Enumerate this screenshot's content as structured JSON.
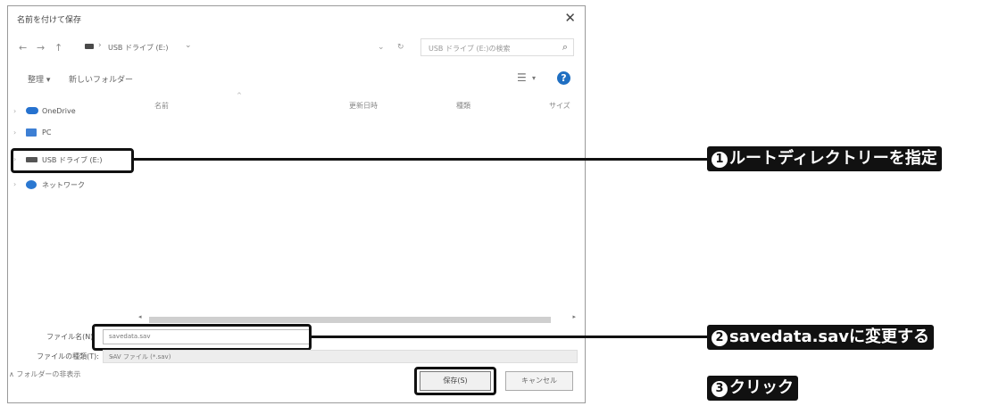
{
  "dialog": {
    "title": "名前を付けて保存",
    "close_glyph": "✕",
    "nav_back": "←",
    "nav_forward": "→",
    "nav_up": "↑",
    "address_text": "USB ドライブ (E:)",
    "address_sep": "›",
    "address_dropdown": "⌄",
    "refresh_dd": "⌄",
    "refresh": "↻",
    "search_placeholder": "USB ドライブ (E:)の検索",
    "search_icon": "⌕"
  },
  "toolbar": {
    "organize_label": "整理 ▾",
    "new_folder_label": "新しいフォルダー",
    "view_icon": "☰",
    "view_dd": "▾",
    "help_icon": "?"
  },
  "nav_pane": {
    "items": [
      {
        "label": "OneDrive",
        "chev": "›"
      },
      {
        "label": "PC",
        "chev": "›"
      },
      {
        "label": "USB ドライブ (E:)",
        "chev": "›"
      },
      {
        "label": "ネットワーク",
        "chev": "›"
      }
    ]
  },
  "columns": [
    "名前",
    "更新日時",
    "種類",
    "サイズ"
  ],
  "sort_arrow": "^",
  "scroll": {
    "left": "◂",
    "right": "▸"
  },
  "form": {
    "filename_label": "ファイル名(N):",
    "filename_value": "savedata.sav",
    "filetype_label": "ファイルの種類(T):",
    "filetype_value": "SAV ファイル (*.sav)",
    "filetype_dd": "⌄",
    "hide_folders": "∧ フォルダーの非表示",
    "save_label": "保存(S)",
    "cancel_label": "キャンセル"
  },
  "callouts": [
    {
      "num": "1",
      "text": "ルートディレクトリーを指定"
    },
    {
      "num": "2",
      "text": "savedata.savに変更する"
    },
    {
      "num": "3",
      "text": "クリック"
    }
  ]
}
